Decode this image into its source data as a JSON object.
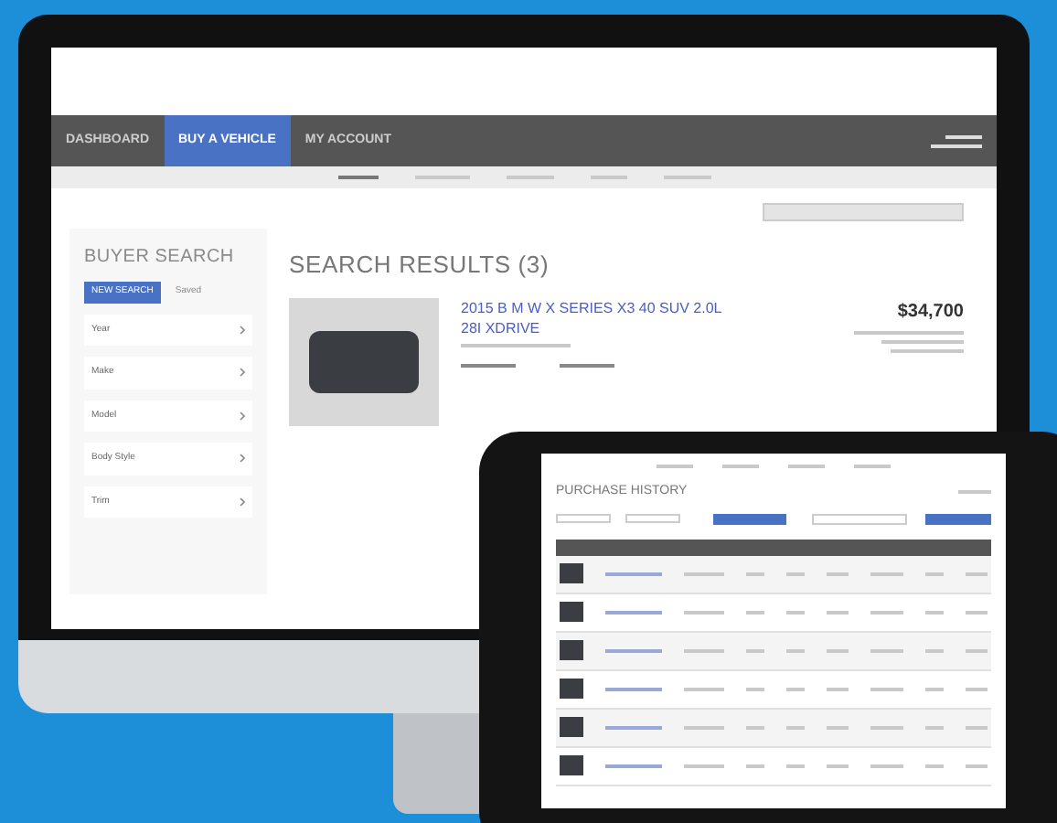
{
  "monitor": {
    "nav_tabs": [
      {
        "label": "DASHBOARD",
        "selected": false
      },
      {
        "label": "BUY A VEHICLE",
        "selected": true
      },
      {
        "label": "MY ACCOUNT",
        "selected": false
      }
    ],
    "sidebar": {
      "title": "BUYER SEARCH",
      "buttons": [
        {
          "label": "NEW SEARCH",
          "selected": true
        },
        {
          "label": "Saved",
          "selected": false
        }
      ],
      "filters": [
        "Year",
        "Make",
        "Model",
        "Body Style",
        "Trim"
      ]
    },
    "results": {
      "heading": "SEARCH RESULTS (3)",
      "listing": {
        "title": "2015 B M W X SERIES X3 40 SUV 2.0L 28I XDRIVE",
        "price": "$34,700"
      }
    }
  },
  "tablet": {
    "title": "PURCHASE HISTORY"
  }
}
